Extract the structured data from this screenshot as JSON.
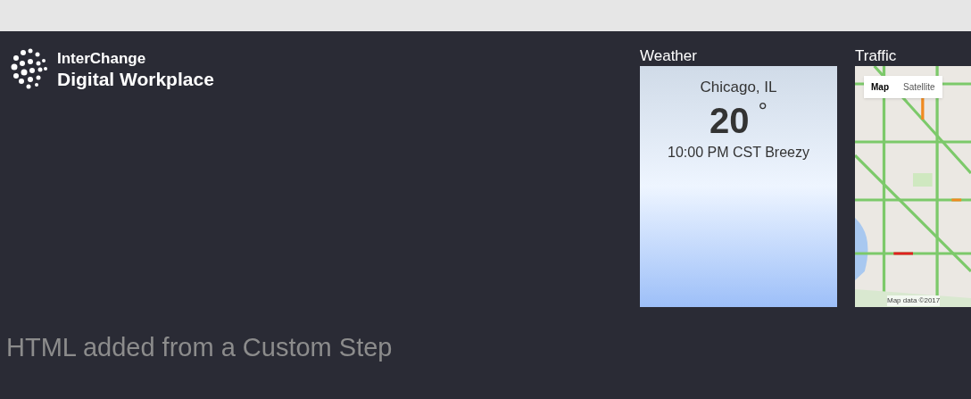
{
  "logo": {
    "line_1": "InterChange",
    "line_2": "Digital Workplace"
  },
  "weather": {
    "title": "Weather",
    "city": "Chicago, IL",
    "temperature": "20",
    "degree": "°",
    "conditions": "10:00 PM CST Breezy"
  },
  "traffic": {
    "title": "Traffic",
    "map_types": [
      {
        "label": "Map",
        "selected": true
      },
      {
        "label": "Satellite",
        "selected": false
      }
    ],
    "attribution": "Map data ©2017"
  },
  "custom_html": "HTML added from a Custom Step"
}
